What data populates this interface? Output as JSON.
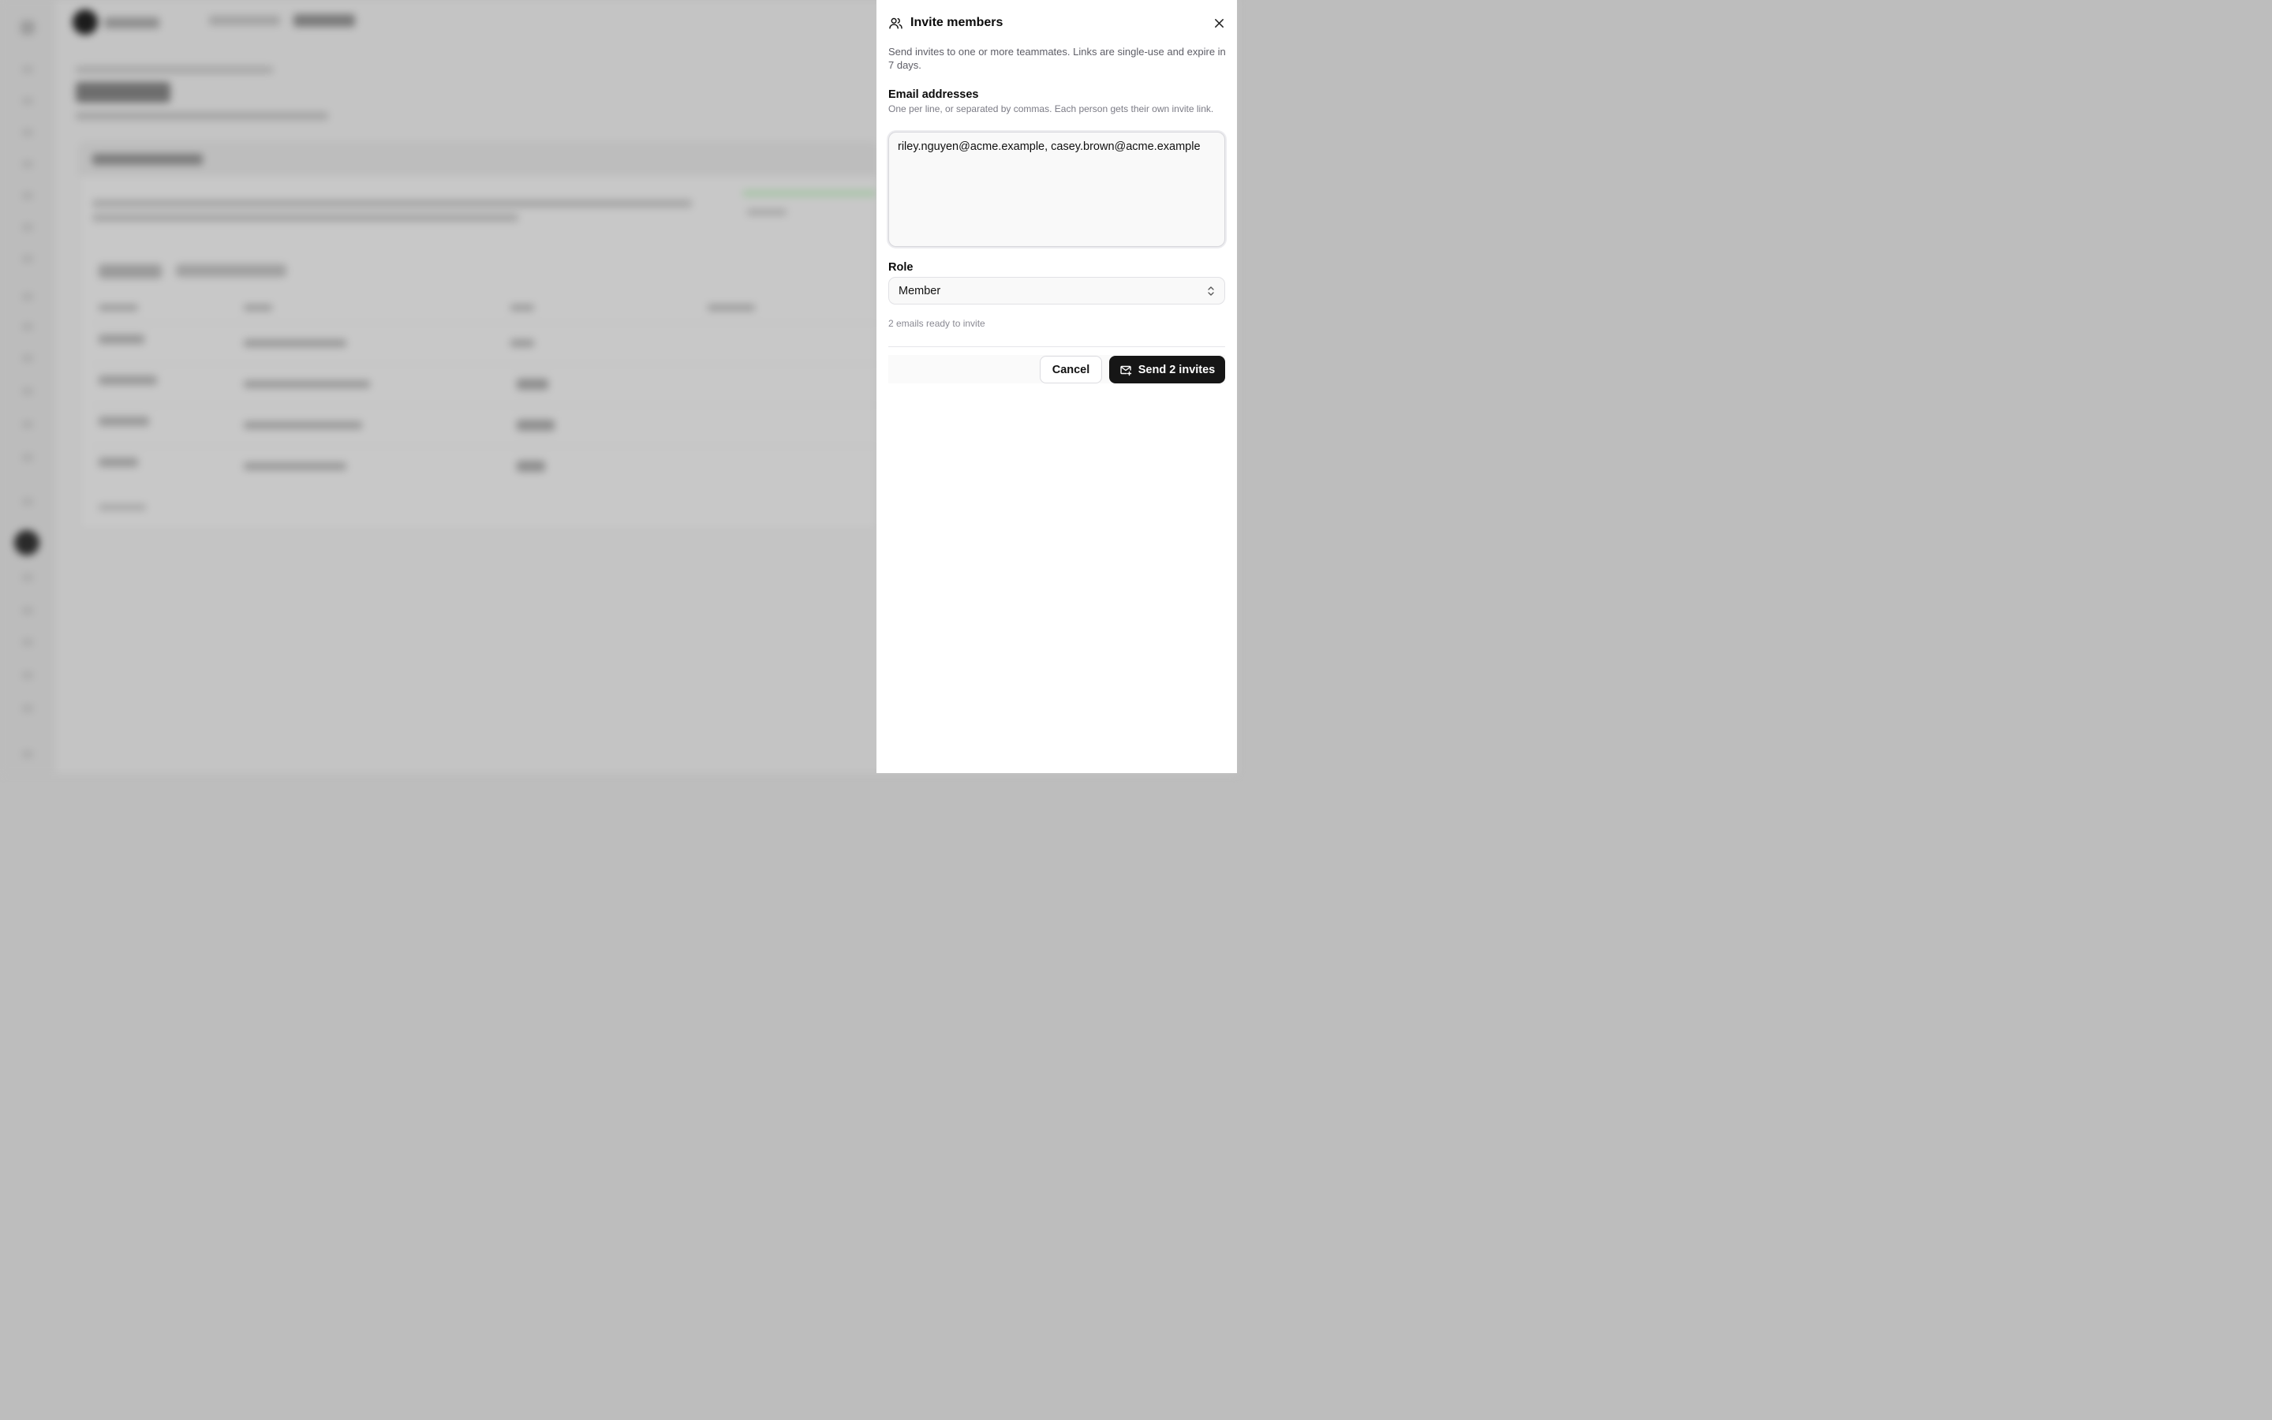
{
  "drawer": {
    "title": "Invite members",
    "header_icon": "users-icon",
    "close_icon": "close-icon",
    "description": "Send invites to one or more teammates. Links are single-use and expire in 7 days.",
    "emails": {
      "label": "Email addresses",
      "hint": "One per line, or separated by commas. Each person gets their own invite link.",
      "value": "riley.nguyen@acme.example, casey.brown@acme.example"
    },
    "role": {
      "label": "Role",
      "selected": "Member",
      "chevron_icon": "chevron-up-down-icon"
    },
    "status": "2 emails ready to invite",
    "actions": {
      "cancel_label": "Cancel",
      "send_label": "Send 2 invites",
      "send_icon": "mail-plus-icon"
    }
  },
  "colors": {
    "primary_button": "#161616",
    "overlay": "#bdbdbd",
    "muted_text": "#5d5d66"
  }
}
